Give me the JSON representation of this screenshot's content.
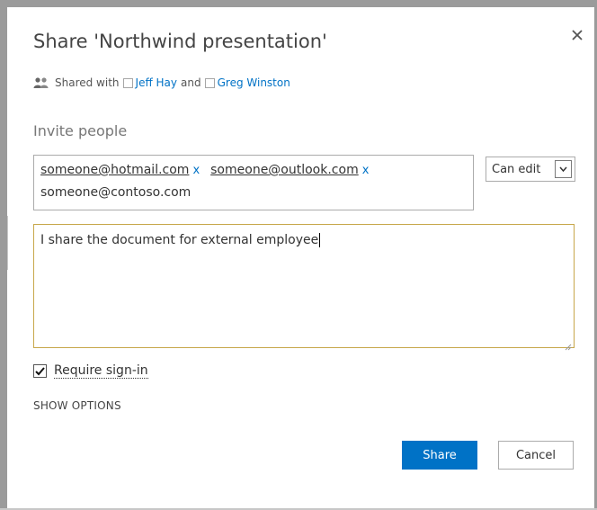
{
  "dialog": {
    "title": "Share 'Northwind presentation'",
    "close_icon": "close-icon"
  },
  "shared_with": {
    "prefix": "Shared with",
    "people_icon": "people-icon",
    "person1": "Jeff Hay",
    "conjunction": "and",
    "person2": "Greg Winston"
  },
  "invite": {
    "label": "Invite people",
    "emails": [
      "someone@hotmail.com",
      "someone@outlook.com",
      "someone@contoso.com"
    ],
    "remove_symbol": "x"
  },
  "permission": {
    "selected": "Can edit"
  },
  "message": {
    "value": "I share the document for external employee"
  },
  "require_signin": {
    "label": "Require sign-in",
    "checked": true
  },
  "show_options": "SHOW OPTIONS",
  "buttons": {
    "share": "Share",
    "cancel": "Cancel"
  },
  "colors": {
    "accent": "#0072c6",
    "message_border": "#c7a74a"
  }
}
